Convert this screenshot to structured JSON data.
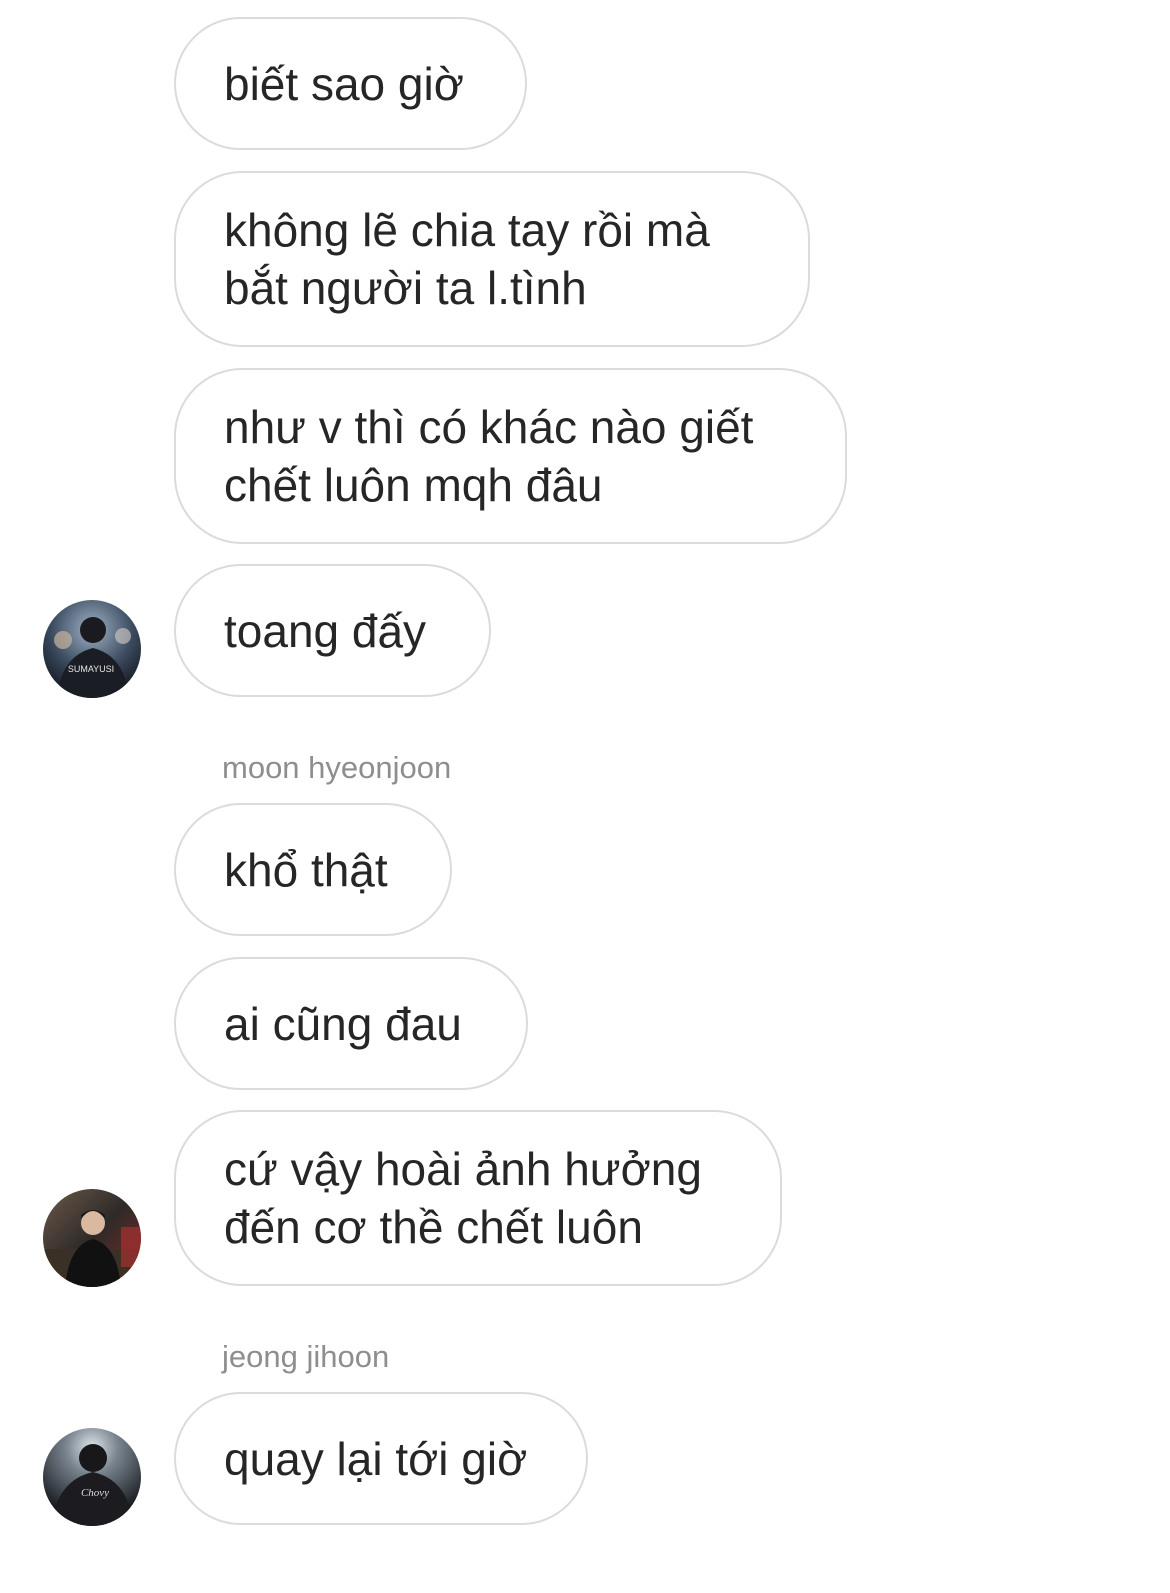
{
  "messages": [
    {
      "text": "biết sao giờ"
    },
    {
      "text": "không lẽ chia tay rồi mà\nbắt người ta l.tình"
    },
    {
      "text": "như v thì có khác nào giết\nchết luôn mqh đâu"
    },
    {
      "text": "toang đấy"
    },
    {
      "text": "khổ thật"
    },
    {
      "text": "ai cũng đau"
    },
    {
      "text": "cứ vậy hoài ảnh hưởng\nđến cơ thề chết luôn"
    },
    {
      "text": "quay lại tới giờ"
    }
  ],
  "senders": {
    "moon": "moon hyeonjoon",
    "jeong": "jeong jihoon"
  },
  "avatars": {
    "first": {
      "jersey_text": "SUMAYUSI"
    },
    "third": {
      "jersey_text": "Chovy"
    }
  }
}
